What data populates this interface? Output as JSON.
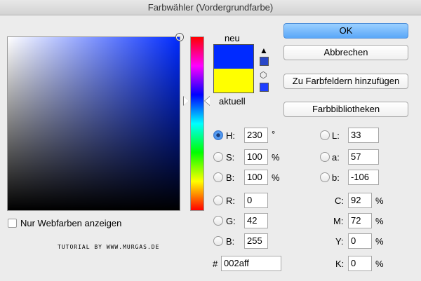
{
  "window": {
    "title": "Farbwähler (Vordergrundfarbe)"
  },
  "colors": {
    "selected": "#002aff",
    "current": "#ffff00",
    "ok_accent": "#5aa7f8"
  },
  "preview": {
    "new_label": "neu",
    "current_label": "aktuell",
    "warning_icon": "warning-triangle-icon",
    "websafe_icon": "cube-icon"
  },
  "buttons": {
    "ok": "OK",
    "cancel": "Abbrechen",
    "add_swatches": "Zu Farbfeldern hinzufügen",
    "libraries": "Farbbibliotheken"
  },
  "hsb": {
    "h": {
      "label": "H:",
      "value": "230",
      "unit": "°"
    },
    "s": {
      "label": "S:",
      "value": "100",
      "unit": "%"
    },
    "b": {
      "label": "B:",
      "value": "100",
      "unit": "%"
    }
  },
  "rgb": {
    "r": {
      "label": "R:",
      "value": "0"
    },
    "g": {
      "label": "G:",
      "value": "42"
    },
    "b": {
      "label": "B:",
      "value": "255"
    }
  },
  "lab": {
    "l": {
      "label": "L:",
      "value": "33"
    },
    "a": {
      "label": "a:",
      "value": "57"
    },
    "b": {
      "label": "b:",
      "value": "-106"
    }
  },
  "cmyk": {
    "c": {
      "label": "C:",
      "value": "92",
      "unit": "%"
    },
    "m": {
      "label": "M:",
      "value": "72",
      "unit": "%"
    },
    "y": {
      "label": "Y:",
      "value": "0",
      "unit": "%"
    },
    "k": {
      "label": "K:",
      "value": "0",
      "unit": "%"
    }
  },
  "hex": {
    "label": "#",
    "value": "002aff"
  },
  "web_colors_only": {
    "label": "Nur Webfarben anzeigen",
    "checked": false
  },
  "watermark": "TUTORIAL BY WWW.MURGAS.DE"
}
